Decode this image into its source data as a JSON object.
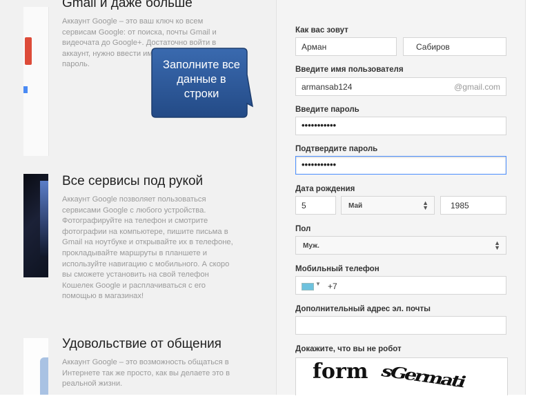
{
  "sections": [
    {
      "title": "Gmail и даже больше",
      "body": "Аккаунт Google – это ваш ключ ко всем сервисам Google: от поиска, почты Gmail и видеочата до Google+. Достаточно войти в аккаунт, нужно ввести имя пользователя и пароль."
    },
    {
      "title": "Все сервисы под рукой",
      "body": "Аккаунт Google позволяет пользоваться сервисами Google с любого устройства. Фотографируйте на телефон и смотрите фотографии на компьютере, пишите письма в Gmail на ноутбуке и открывайте их в телефоне, прокладывайте маршруты в планшете и используйте навигацию с мобильного. А скоро вы сможете установить на свой телефон Кошелек Google и расплачиваться с его помощью в магазинах!"
    },
    {
      "title": "Удовольствие от общения",
      "body": "Аккаунт Google – это возможность общаться в Интернете так же просто, как вы делаете это в реальной жизни."
    }
  ],
  "callout": {
    "text": "Заполните все данные в строки",
    "color": "#2f5b9b"
  },
  "form": {
    "name_label": "Как вас зовут",
    "first_name": "Арман",
    "last_name": "Сабиров",
    "username_label": "Введите имя пользователя",
    "username": "armansab124",
    "username_suffix": "@gmail.com",
    "password_label": "Введите пароль",
    "password_mask": "•••••••••••",
    "confirm_label": "Подтвердите пароль",
    "confirm_mask": "•••••••••••",
    "birth_label": "Дата рождения",
    "birth_day": "5",
    "birth_month": "Май",
    "birth_year": "1985",
    "gender_label": "Пол",
    "gender": "Муж.",
    "phone_label": "Мобильный телефон",
    "phone_code": "+7",
    "email_label": "Дополнительный адрес эл. почты",
    "email": "",
    "robot_label": "Докажите, что вы не робот",
    "captcha_word1": "form",
    "captcha_word2": "sGermati"
  },
  "icons": {
    "select_arrows": "up-down-arrows",
    "country_flag": "kazakhstan-flag",
    "dropdown_caret": "caret-down"
  }
}
